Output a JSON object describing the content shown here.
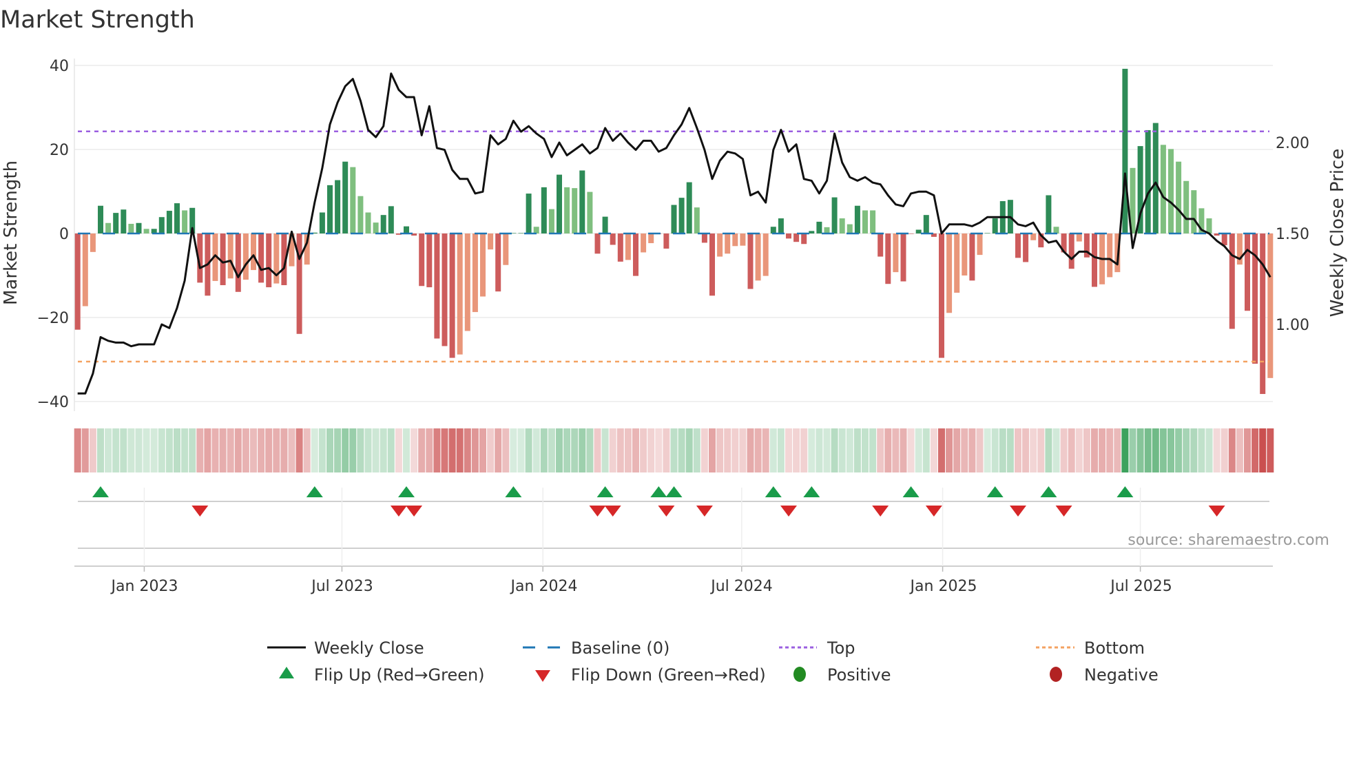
{
  "chart_data": {
    "type": "bar",
    "title": "Market Strength",
    "ylabel": "Market Strength",
    "y2label": "Weekly Close Price",
    "ylim": [
      -42,
      42
    ],
    "y2lim": [
      0.55,
      2.45
    ],
    "yticks": [
      "40",
      "20",
      "0",
      "−20",
      "−40"
    ],
    "ytick_values": [
      40,
      20,
      0,
      -20,
      -40
    ],
    "y2ticks": [
      "2.00",
      "1.50",
      "1.00"
    ],
    "y2tick_values": [
      2.0,
      1.5,
      1.0
    ],
    "xticks": [
      {
        "label": "Jan 2023",
        "date": "2023-01-01"
      },
      {
        "label": "Jul 2023",
        "date": "2023-07-01"
      },
      {
        "label": "Jan 2024",
        "date": "2024-01-01"
      },
      {
        "label": "Jul 2024",
        "date": "2024-07-01"
      },
      {
        "label": "Jan 2025",
        "date": "2025-01-01"
      },
      {
        "label": "Jul 2025",
        "date": "2025-07-01"
      }
    ],
    "start_week": "2022-11-01",
    "frequency": "weekly",
    "top_level": 24.3,
    "bottom_level": -30.5,
    "baseline": 0,
    "strength": [
      -22.9,
      -17.3,
      -4.4,
      6.6,
      2.5,
      4.9,
      5.7,
      2.3,
      2.5,
      1.1,
      1.1,
      3.9,
      5.4,
      7.2,
      5.5,
      6.1,
      -11.7,
      -14.8,
      -11.3,
      -12.3,
      -10.7,
      -13.9,
      -11.0,
      -8.7,
      -11.7,
      -12.8,
      -11.9,
      -12.3,
      -7.8,
      -23.9,
      -7.4,
      0.2,
      5.0,
      11.5,
      12.7,
      17.1,
      15.8,
      8.9,
      5.0,
      2.6,
      4.4,
      6.5,
      -0.3,
      1.7,
      -0.5,
      -12.5,
      -12.8,
      -25.0,
      -26.8,
      -29.6,
      -28.8,
      -23.2,
      -18.7,
      -15.0,
      -3.8,
      -13.8,
      -7.5,
      0.1,
      0.1,
      9.5,
      1.6,
      11.0,
      5.8,
      14.0,
      11.0,
      10.8,
      15.0,
      9.9,
      -4.8,
      4.0,
      -2.7,
      -6.7,
      -6.3,
      -10.1,
      -4.5,
      -2.3,
      -0.1,
      -3.6,
      6.8,
      8.5,
      12.2,
      6.2,
      -2.2,
      -14.8,
      -5.5,
      -4.8,
      -3.0,
      -2.9,
      -13.2,
      -11.2,
      -10.1,
      1.6,
      3.6,
      -1.2,
      -2.0,
      -2.5,
      0.6,
      2.8,
      1.5,
      8.6,
      3.6,
      2.2,
      6.6,
      5.5,
      5.5,
      -5.5,
      -12.0,
      -9.2,
      -11.4,
      -0.1,
      0.9,
      4.4,
      -0.8,
      -29.6,
      -18.9,
      -14.1,
      -10.0,
      -11.2,
      -5.1,
      0.1,
      3.6,
      7.7,
      8.0,
      -5.8,
      -6.8,
      -1.6,
      -3.3,
      9.1,
      1.6,
      -4.5,
      -8.4,
      -1.9,
      -5.7,
      -12.7,
      -12.1,
      -10.4,
      -9.2,
      39.2,
      15.6,
      20.8,
      24.6,
      26.3,
      21.1,
      20.1,
      17.1,
      12.5,
      10.3,
      6.0,
      3.6,
      -0.5,
      -2.8,
      -22.7,
      -7.4,
      -18.4,
      -31.0,
      -38.2,
      -34.4
    ],
    "shade": "RrrGgGGgGgGGGGgGRRrRrRrrRRrRrRrGGGGGggggGGRGRRRRRRrrrrrRrGGGgGgGggGgRGRRrRrrRRGGGgRRrrrrRrrGGRRRGGgGggGggRRrRRGGRRrrrRrGGGGRRrRGgRRrRRrrrGgGGGgggggggRRRrRRRr",
    "weekly_close": [
      0.62,
      0.62,
      0.73,
      0.93,
      0.91,
      0.9,
      0.9,
      0.88,
      0.89,
      0.89,
      0.89,
      1.0,
      0.98,
      1.09,
      1.24,
      1.53,
      1.31,
      1.33,
      1.38,
      1.34,
      1.35,
      1.26,
      1.33,
      1.38,
      1.3,
      1.31,
      1.27,
      1.31,
      1.51,
      1.36,
      1.45,
      1.67,
      1.86,
      2.1,
      2.22,
      2.31,
      2.35,
      2.23,
      2.07,
      2.03,
      2.09,
      2.38,
      2.29,
      2.25,
      2.25,
      2.04,
      2.2,
      1.97,
      1.96,
      1.85,
      1.8,
      1.8,
      1.72,
      1.73,
      2.04,
      1.99,
      2.02,
      2.12,
      2.06,
      2.09,
      2.05,
      2.02,
      1.92,
      2.0,
      1.93,
      1.96,
      1.99,
      1.94,
      1.97,
      2.08,
      2.01,
      2.05,
      2.0,
      1.96,
      2.01,
      2.01,
      1.95,
      1.97,
      2.04,
      2.1,
      2.19,
      2.08,
      1.96,
      1.8,
      1.9,
      1.95,
      1.94,
      1.91,
      1.71,
      1.73,
      1.67,
      1.96,
      2.07,
      1.95,
      1.99,
      1.8,
      1.79,
      1.72,
      1.79,
      2.05,
      1.89,
      1.81,
      1.79,
      1.81,
      1.78,
      1.77,
      1.71,
      1.66,
      1.65,
      1.72,
      1.73,
      1.73,
      1.71,
      1.5,
      1.55,
      1.55,
      1.55,
      1.54,
      1.56,
      1.59,
      1.59,
      1.59,
      1.59,
      1.55,
      1.54,
      1.56,
      1.49,
      1.45,
      1.46,
      1.4,
      1.36,
      1.4,
      1.4,
      1.37,
      1.36,
      1.36,
      1.33,
      1.83,
      1.42,
      1.61,
      1.72,
      1.78,
      1.7,
      1.67,
      1.63,
      1.58,
      1.58,
      1.52,
      1.5,
      1.46,
      1.43,
      1.38,
      1.36,
      1.41,
      1.38,
      1.33,
      1.26
    ],
    "flip_up_weeks": [
      4,
      32,
      44,
      58,
      70,
      77,
      79,
      92,
      97,
      110,
      121,
      128,
      138
    ],
    "flip_down_weeks": [
      17,
      43,
      45,
      69,
      71,
      78,
      83,
      94,
      106,
      113,
      124,
      130,
      150
    ],
    "legend": {
      "placement": "bottom",
      "items": [
        {
          "label": "Weekly Close",
          "symbol": "line",
          "color": "#111111"
        },
        {
          "label": "Baseline (0)",
          "symbol": "dash",
          "color": "#1f77b4"
        },
        {
          "label": "Top",
          "symbol": "dot",
          "color": "#9b5fe0"
        },
        {
          "label": "Bottom",
          "symbol": "dot",
          "color": "#f4a261"
        },
        {
          "label": "Flip Up (Red→Green)",
          "symbol": "triangle-up",
          "color": "#1a9c4a"
        },
        {
          "label": "Flip Down (Green→Red)",
          "symbol": "triangle-down",
          "color": "#d62728"
        },
        {
          "label": "Positive",
          "symbol": "circle",
          "color": "#228b22"
        },
        {
          "label": "Negative",
          "symbol": "circle",
          "color": "#b22222"
        }
      ]
    },
    "colors": {
      "G": "#2e8b57",
      "g": "#7fbf7f",
      "R": "#cd5c5c",
      "r": "#e9967a"
    },
    "source": "source: sharemaestro.com"
  }
}
